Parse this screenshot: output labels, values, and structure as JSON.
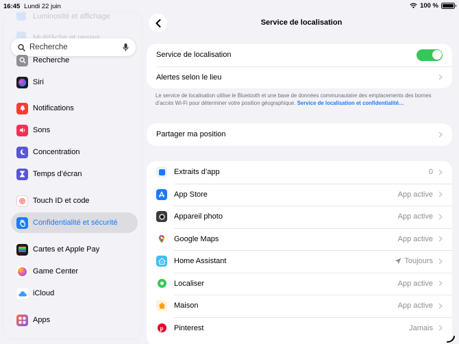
{
  "status": {
    "time": "16:45",
    "date": "Lundi 22 juin",
    "battery": "100 %"
  },
  "sidebar": {
    "ghost_items": [
      "Luminosité et affichage",
      "Multitâche et gestes"
    ],
    "search_placeholder": "Recherche",
    "items": [
      {
        "label": "Recherche",
        "icon": "search-icon",
        "color": "#8e8e93"
      },
      {
        "label": "Siri",
        "icon": "siri-icon",
        "color": "#1c1c1e"
      },
      {
        "label": "Notifications",
        "icon": "bell-icon",
        "color": "#ff3b30"
      },
      {
        "label": "Sons",
        "icon": "speaker-icon",
        "color": "#ff2d55"
      },
      {
        "label": "Concentration",
        "icon": "moon-icon",
        "color": "#5856d6"
      },
      {
        "label": "Temps d’écran",
        "icon": "hourglass-icon",
        "color": "#5856d6"
      },
      {
        "label": "Touch ID et code",
        "icon": "fingerprint-icon",
        "color": "#ff6b6b"
      },
      {
        "label": "Confidentialité et sécurité",
        "icon": "hand-icon",
        "color": "#1a7cf5",
        "selected": true
      },
      {
        "label": "Cartes et Apple Pay",
        "icon": "wallet-icon",
        "color": "#1c1c1e"
      },
      {
        "label": "Game Center",
        "icon": "gamecenter-icon",
        "color": "#e84fd2"
      },
      {
        "label": "iCloud",
        "icon": "cloud-icon",
        "color": "#ffffff"
      },
      {
        "label": "Apps",
        "icon": "apps-icon",
        "color": "#7a5af8"
      }
    ]
  },
  "main": {
    "title": "Service de localisation",
    "location_service_label": "Service de localisation",
    "location_service_on": true,
    "alerts_label": "Alertes selon le lieu",
    "note_text": "Le service de localisation utilise le Bluetooth et une base de données communautaire des emplacements des bornes d’accès Wi-Fi pour déterminer votre position géographique. ",
    "note_link": "Service de localisation et confidentialité…",
    "share_label": "Partager ma position",
    "apps": [
      {
        "name": "Extraits d’app",
        "value": "0",
        "icon": "app-clips-icon",
        "color": "#1a7cf5"
      },
      {
        "name": "App Store",
        "value": "App active",
        "icon": "app-store-icon",
        "color": "#1a7cf5"
      },
      {
        "name": "Appareil photo",
        "value": "App active",
        "icon": "camera-icon",
        "color": "#3a3a3c"
      },
      {
        "name": "Google Maps",
        "value": "App active",
        "icon": "google-maps-icon",
        "color": "#ffffff"
      },
      {
        "name": "Home Assistant",
        "value": "Toujours",
        "icon": "home-assistant-icon",
        "color": "#41bdf5",
        "arrow": true
      },
      {
        "name": "Localiser",
        "value": "App active",
        "icon": "find-my-icon",
        "color": "#34c759"
      },
      {
        "name": "Maison",
        "value": "App active",
        "icon": "home-icon",
        "color": "#ff9f0a"
      },
      {
        "name": "Pinterest",
        "value": "Jamais",
        "icon": "pinterest-icon",
        "color": "#e60023"
      }
    ]
  }
}
